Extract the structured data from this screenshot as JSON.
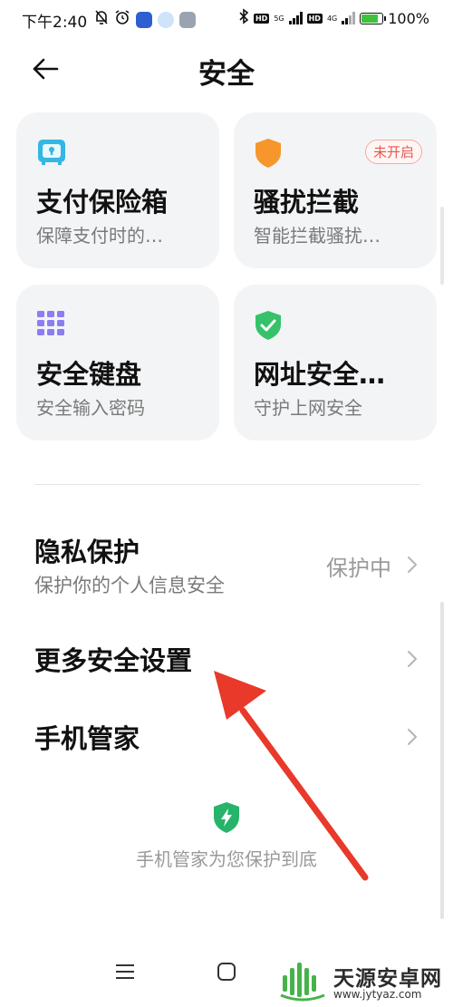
{
  "status_bar": {
    "time": "下午2:40",
    "network_5g": "5G",
    "network_4g": "4G",
    "hd": "HD",
    "battery_pct": "100%"
  },
  "header": {
    "title": "安全",
    "back_icon": "arrow-left-icon"
  },
  "cards": [
    {
      "title": "支付保险箱",
      "subtitle": "保障支付时的…",
      "icon": "safe-box-icon",
      "color": "#35b6e3"
    },
    {
      "title": "骚扰拦截",
      "subtitle": "智能拦截骚扰…",
      "icon": "shield-icon",
      "color": "#f6962b",
      "badge": "未开启"
    },
    {
      "title": "安全键盘",
      "subtitle": "安全输入密码",
      "icon": "keypad-icon",
      "color": "#8a7ef0"
    },
    {
      "title": "网址安全…",
      "subtitle": "守护上网安全",
      "icon": "shield-check-icon",
      "color": "#36c26a"
    }
  ],
  "list": [
    {
      "title": "隐私保护",
      "subtitle": "保护你的个人信息安全",
      "value": "保护中"
    },
    {
      "title": "更多安全设置"
    },
    {
      "title": "手机管家"
    }
  ],
  "footer": {
    "text": "手机管家为您保护到底",
    "icon": "shield-bolt-icon",
    "color": "#28b36b"
  },
  "nav": {
    "menu_icon": "menu-icon",
    "home_icon": "home-square-icon",
    "back_icon": "back-icon"
  },
  "annotation": {
    "arrow_color": "#e8392a"
  },
  "watermark": {
    "text": "天源安卓网",
    "url": "www.jytyaz.com"
  }
}
